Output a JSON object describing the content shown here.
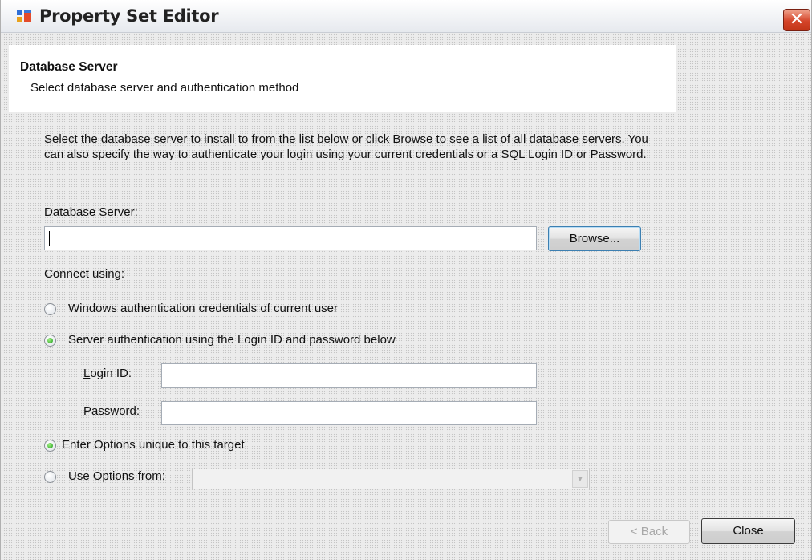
{
  "window": {
    "title": "Property Set Editor",
    "close_glyph": "✕"
  },
  "header": {
    "title": "Database Server",
    "subtitle": "Select database server and authentication method"
  },
  "description": "Select the database server to install to from the list below or click Browse to see a list of all database servers.  You can also specify the way to authenticate your login using your current credentials or a SQL Login ID or Password.",
  "db_server": {
    "label_key": "D",
    "label_rest": "atabase Server:",
    "value": "",
    "browse_label": "Browse..."
  },
  "connect": {
    "label": "Connect using:",
    "options": [
      {
        "label": "Windows authentication credentials of current user",
        "selected": false
      },
      {
        "label": "Server authentication using the Login ID and password below",
        "selected": true
      }
    ]
  },
  "credentials": {
    "login_key": "L",
    "login_rest": "ogin ID:",
    "login_value": "",
    "password_key": "P",
    "password_rest": "assword:",
    "password_value": ""
  },
  "options": {
    "unique": {
      "label": "Enter Options unique to this target",
      "selected": true
    },
    "from": {
      "label": "Use Options from:",
      "selected": false,
      "value": ""
    }
  },
  "footer": {
    "back_label": "< Back",
    "close_label": "Close"
  },
  "icons": {
    "app": "app-window-icon",
    "close": "close-icon",
    "dropdown": "chevron-down-icon"
  }
}
